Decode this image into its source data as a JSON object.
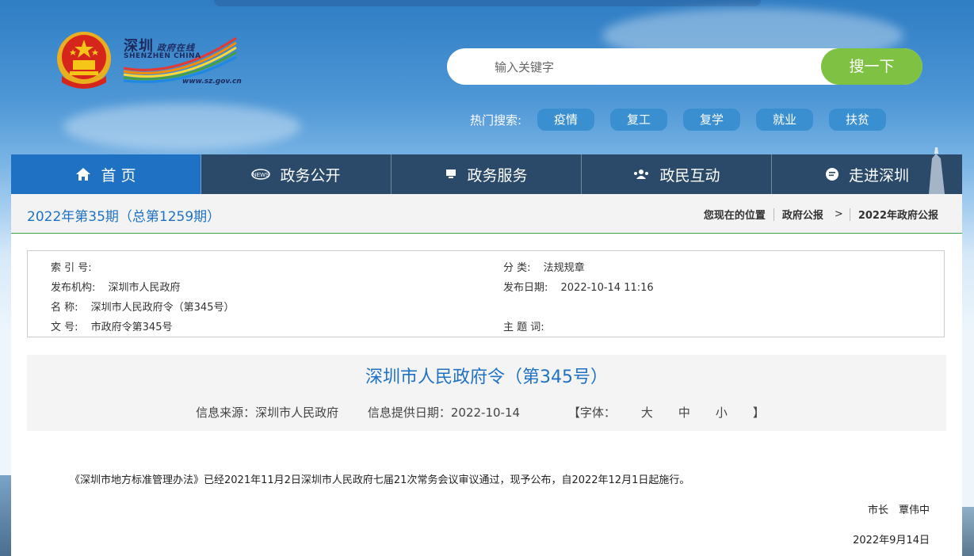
{
  "header": {
    "logo": {
      "brand_cn": "深圳",
      "brand_cn_small": "政府在线",
      "brand_en": "SHENZHEN CHINA",
      "url": "www.sz.gov.cn"
    },
    "search": {
      "placeholder": "输入关键字",
      "button": "搜一下"
    },
    "hot_search": {
      "label": "热门搜索:",
      "tags": [
        "疫情",
        "复工",
        "复学",
        "就业",
        "扶贫"
      ]
    }
  },
  "nav": {
    "items": [
      {
        "label": "首 页",
        "icon": "home-icon",
        "active": true
      },
      {
        "label": "政务公开",
        "icon": "news-icon",
        "active": false
      },
      {
        "label": "政务服务",
        "icon": "monitor-icon",
        "active": false
      },
      {
        "label": "政民互动",
        "icon": "people-icon",
        "active": false
      },
      {
        "label": "走进深圳",
        "icon": "chat-icon",
        "active": false
      }
    ]
  },
  "crumbbar": {
    "issue": "2022年第35期（总第1259期）",
    "location_label": "您现在的位置",
    "crumbs": [
      "政府公报",
      ">",
      "2022年政府公报"
    ]
  },
  "meta": {
    "index_label": "索 引 号:",
    "index_value": "",
    "category_label": "分 类:",
    "category_value": "法规规章",
    "publisher_label": "发布机构:",
    "publisher_value": "深圳市人民政府",
    "date_label": "发布日期:",
    "date_value": "2022-10-14 11:16",
    "name_label": "名 称:",
    "name_value": "深圳市人民政府令（第345号）",
    "number_label": "文 号:",
    "number_value": "市政府令第345号",
    "keywords_label": "主 题 词:",
    "keywords_value": ""
  },
  "document": {
    "title": "深圳市人民政府令（第345号）",
    "source": "信息来源：深圳市人民政府",
    "provided_date": "信息提供日期：2022-10-14",
    "font_label": "【字体：",
    "font_large": "大",
    "font_medium": "中",
    "font_small": "小",
    "font_close": "】",
    "body": "《深圳市地方标准管理办法》已经2021年11月2日深圳市人民政府七届21次常务会议审议通过，现予公布，自2022年12月1日起施行。",
    "signer": "市长　覃伟中",
    "sign_date": "2022年9月14日"
  },
  "colors": {
    "nav_bg": "#2b4a6a",
    "nav_active": "#1f72c3",
    "search_button": "#7fc243",
    "hot_tag": "#3a8fd0",
    "accent_line": "#3da14a"
  }
}
